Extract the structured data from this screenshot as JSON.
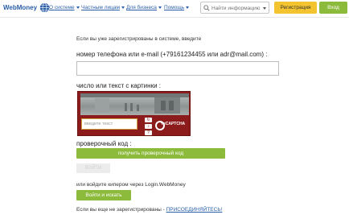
{
  "header": {
    "logo_text": "WebMoney",
    "nav": [
      {
        "label": "О системе"
      },
      {
        "label": "Частным лицам"
      },
      {
        "label": "Для бизнеса"
      },
      {
        "label": "Помощь"
      }
    ],
    "search_placeholder": "Найти информацию",
    "register_label": "Регистрация",
    "login_label": "Вход"
  },
  "form": {
    "intro": "Если вы уже зарегистрированы в системе, введите",
    "phone_label": "номер телефона или e-mail (+79161234455 или adr@mail.com) :",
    "phone_value": "",
    "captcha_label": "число или текст с картинки :",
    "captcha_input_placeholder": "введите текст",
    "recaptcha_brand": "reCAPTCHA",
    "code_label": "проверочный код :",
    "get_code_label": "получить проверочный код",
    "disabled_button_label": "ВОЙТИ",
    "login_via": "или войдите кипером через Login.WebMoney",
    "login_search_label": "Войти и искать",
    "not_registered_prefix": "Если вы еще не зарегистрированы - ",
    "join_label": "ПРИСОЕДИНЯЙТЕСЬ!"
  },
  "colors": {
    "brand_blue": "#2a5fa8",
    "accent_green": "#8cba3a",
    "register_yellow": "#f4c430",
    "captcha_red": "#8c1c1c"
  }
}
